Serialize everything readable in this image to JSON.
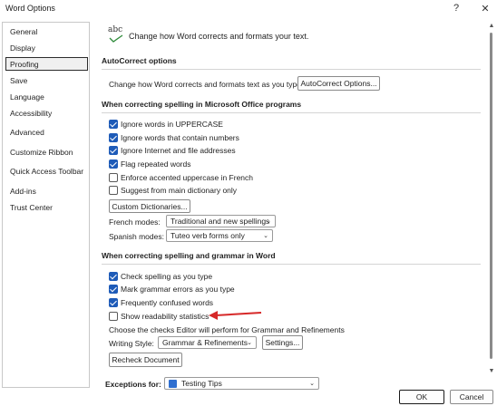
{
  "window": {
    "title": "Word Options",
    "help_icon": "?",
    "close_icon": "✕"
  },
  "nav": {
    "items": [
      {
        "label": "General"
      },
      {
        "label": "Display"
      },
      {
        "label": "Proofing"
      },
      {
        "label": "Save"
      },
      {
        "label": "Language"
      },
      {
        "label": "Accessibility"
      },
      {
        "label": "Advanced"
      },
      {
        "label": "Customize Ribbon"
      },
      {
        "label": "Quick Access Toolbar"
      },
      {
        "label": "Add-ins"
      },
      {
        "label": "Trust Center"
      }
    ],
    "selected": "Proofing"
  },
  "header": {
    "icon_text": "abc",
    "description": "Change how Word corrects and formats your text."
  },
  "autocorrect": {
    "heading": "AutoCorrect options",
    "label": "Change how Word corrects and formats text as you type:",
    "button": "AutoCorrect Options..."
  },
  "office_spelling": {
    "heading": "When correcting spelling in Microsoft Office programs",
    "options": [
      {
        "label": "Ignore words in UPPERCASE",
        "checked": true
      },
      {
        "label": "Ignore words that contain numbers",
        "checked": true
      },
      {
        "label": "Ignore Internet and file addresses",
        "checked": true
      },
      {
        "label": "Flag repeated words",
        "checked": true
      },
      {
        "label": "Enforce accented uppercase in French",
        "checked": false
      },
      {
        "label": "Suggest from main dictionary only",
        "checked": false
      }
    ],
    "custom_dictionaries_button": "Custom Dictionaries...",
    "french_modes_label": "French modes:",
    "french_modes_value": "Traditional and new spellings",
    "spanish_modes_label": "Spanish modes:",
    "spanish_modes_value": "Tuteo verb forms only"
  },
  "word_spelling": {
    "heading": "When correcting spelling and grammar in Word",
    "options": [
      {
        "label": "Check spelling as you type",
        "checked": true
      },
      {
        "label": "Mark grammar errors as you type",
        "checked": true
      },
      {
        "label": "Frequently confused words",
        "checked": true
      },
      {
        "label": "Show readability statistics",
        "checked": false
      }
    ],
    "editor_note": "Choose the checks Editor will perform for Grammar and Refinements",
    "writing_style_label": "Writing Style:",
    "writing_style_value": "Grammar & Refinements",
    "settings_button": "Settings...",
    "recheck_button": "Recheck Document"
  },
  "exceptions": {
    "label": "Exceptions for:",
    "value": "Testing Tips"
  },
  "footer": {
    "ok": "OK",
    "cancel": "Cancel"
  },
  "colors": {
    "accent": "#1e5bb8",
    "arrow": "#d62828"
  }
}
